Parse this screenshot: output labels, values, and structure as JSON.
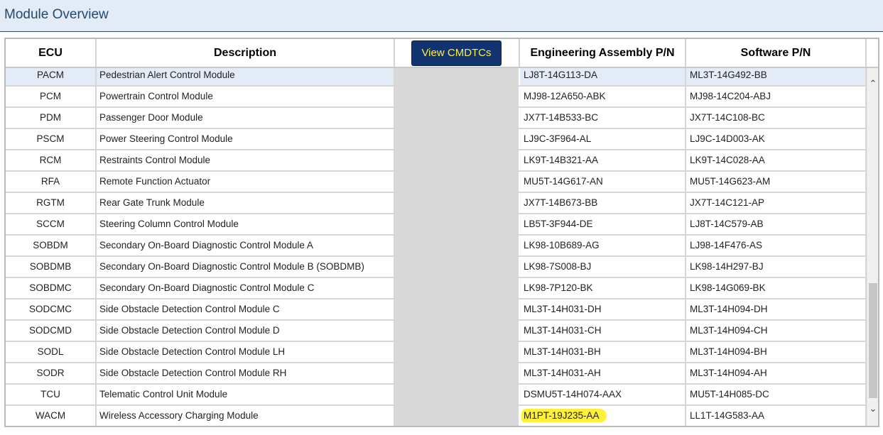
{
  "page": {
    "title": "Module Overview"
  },
  "table": {
    "headers": {
      "ecu": "ECU",
      "description": "Description",
      "view_button": "View CMDTCs",
      "engineering": "Engineering Assembly P/N",
      "software": "Software P/N"
    },
    "rows": [
      {
        "ecu": "PACM",
        "description": "Pedestrian Alert Control Module",
        "engineering": "LJ8T-14G113-DA",
        "software": "ML3T-14G492-BB"
      },
      {
        "ecu": "PCM",
        "description": "Powertrain Control Module",
        "engineering": "MJ98-12A650-ABK",
        "software": "MJ98-14C204-ABJ"
      },
      {
        "ecu": "PDM",
        "description": "Passenger Door Module",
        "engineering": "JX7T-14B533-BC",
        "software": "JX7T-14C108-BC"
      },
      {
        "ecu": "PSCM",
        "description": "Power Steering Control Module",
        "engineering": "LJ9C-3F964-AL",
        "software": "LJ9C-14D003-AK"
      },
      {
        "ecu": "RCM",
        "description": "Restraints Control Module",
        "engineering": "LK9T-14B321-AA",
        "software": "LK9T-14C028-AA"
      },
      {
        "ecu": "RFA",
        "description": "Remote Function Actuator",
        "engineering": "MU5T-14G617-AN",
        "software": "MU5T-14G623-AM"
      },
      {
        "ecu": "RGTM",
        "description": "Rear Gate Trunk Module",
        "engineering": "JX7T-14B673-BB",
        "software": "JX7T-14C121-AP"
      },
      {
        "ecu": "SCCM",
        "description": "Steering Column Control Module",
        "engineering": "LB5T-3F944-DE",
        "software": "LJ8T-14C579-AB"
      },
      {
        "ecu": "SOBDM",
        "description": "Secondary On-Board Diagnostic Control Module A",
        "engineering": "LK98-10B689-AG",
        "software": "LJ98-14F476-AS"
      },
      {
        "ecu": "SOBDMB",
        "description": "Secondary On-Board Diagnostic Control Module B (SOBDMB)",
        "engineering": "LK98-7S008-BJ",
        "software": "LK98-14H297-BJ"
      },
      {
        "ecu": "SOBDMC",
        "description": "Secondary On-Board Diagnostic Control Module C",
        "engineering": "LK98-7P120-BK",
        "software": "LK98-14G069-BK"
      },
      {
        "ecu": "SODCMC",
        "description": "Side Obstacle Detection Control Module C",
        "engineering": "ML3T-14H031-DH",
        "software": "ML3T-14H094-DH"
      },
      {
        "ecu": "SODCMD",
        "description": "Side Obstacle Detection Control Module D",
        "engineering": "ML3T-14H031-CH",
        "software": "ML3T-14H094-CH"
      },
      {
        "ecu": "SODL",
        "description": "Side Obstacle Detection Control Module LH",
        "engineering": "ML3T-14H031-BH",
        "software": "ML3T-14H094-BH"
      },
      {
        "ecu": "SODR",
        "description": "Side Obstacle Detection Control Module RH",
        "engineering": "ML3T-14H031-AH",
        "software": "ML3T-14H094-AH"
      },
      {
        "ecu": "TCU",
        "description": "Telematic Control Unit Module",
        "engineering": "DSMU5T-14H074-AAX",
        "software": "MU5T-14H085-DC"
      },
      {
        "ecu": "WACM",
        "description": "Wireless Accessory Charging Module",
        "engineering": "M1PT-19J235-AA",
        "software": "LL1T-14G583-AA"
      }
    ]
  },
  "scrollbar": {
    "up_icon": "chevron-up-icon",
    "down_icon": "chevron-down-icon"
  },
  "colors": {
    "button_bg": "#11336f",
    "button_text": "#ffef3a",
    "highlight": "#fff13a",
    "title": "#24486e"
  }
}
